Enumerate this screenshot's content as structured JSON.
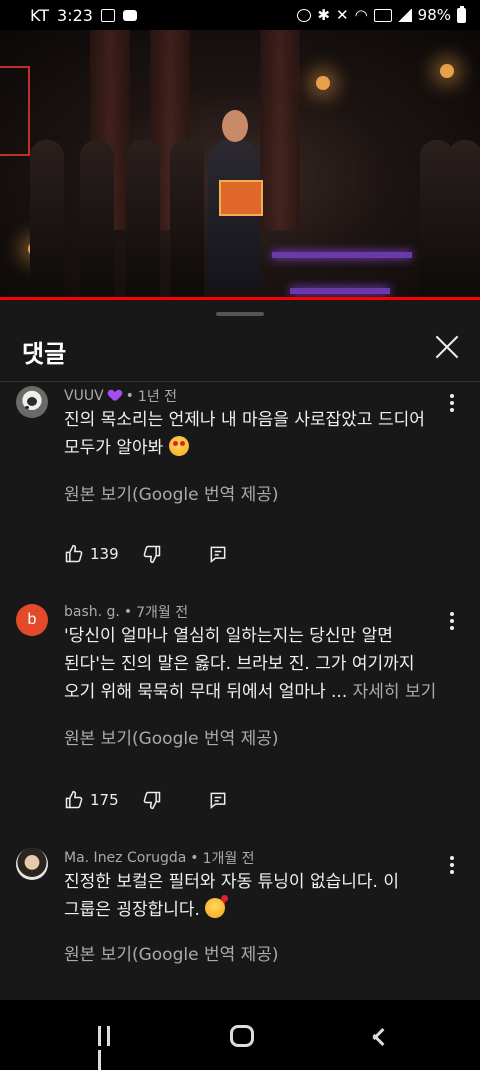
{
  "status_bar": {
    "carrier": "KT",
    "time": "3:23",
    "battery": "98%",
    "icons": [
      "image-icon",
      "talk-icon",
      "alarm-icon",
      "bluetooth-icon",
      "mute-icon",
      "wifi-icon",
      "hd-icon",
      "signal-icon",
      "battery-icon"
    ]
  },
  "video": {
    "progress": 1.0
  },
  "panel": {
    "title": "댓글"
  },
  "comments": [
    {
      "author": "VUUV",
      "badge": "purple-heart",
      "time": "1년 전",
      "line1": "진의 목소리는 언제나 내 마음을 사로잡았고 드디어",
      "line2": "모두가 알아봐",
      "emoji": "heart-eyes-emoji",
      "translate": "원본 보기(Google 번역 제공)",
      "likes": "139"
    },
    {
      "author": "bash. g.",
      "avatar_letter": "b",
      "time": "7개월 전",
      "line1": "'당신이 얼마나 열심히 일하는지는 당신만 알면",
      "line2": "된다'는 진의 말은 옳다. 브라보 진. 그가 여기까지",
      "line3": "오기 위해 묵묵히 무대 뒤에서 얼마나 ...",
      "more": "자세히 보기",
      "translate": "원본 보기(Google 번역 제공)",
      "likes": "175"
    },
    {
      "author": "Ma. Inez Corugda",
      "time": "1개월 전",
      "line1": "진정한 보컬은 필터와 자동 튜닝이 없습니다. 이",
      "line2": "그룹은 굉장합니다.",
      "emoji": "smiling-hearts-emoji",
      "translate": "원본 보기(Google 번역 제공)"
    }
  ],
  "dot": "•"
}
